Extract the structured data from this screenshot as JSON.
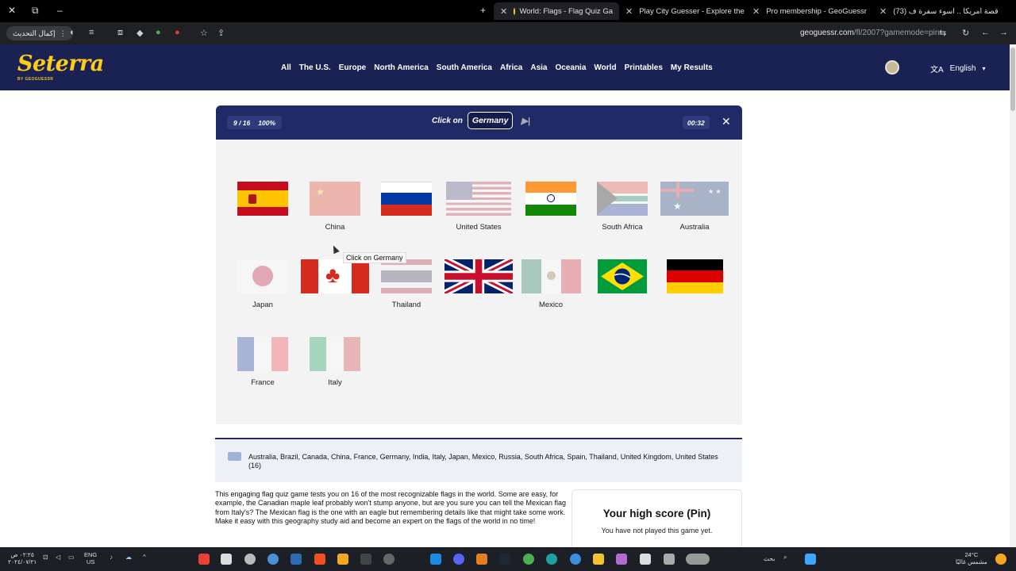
{
  "browser": {
    "tabs": [
      {
        "title": "World: Flags - Flag Quiz Ga",
        "active": true,
        "favicon_color": "#fecd19"
      },
      {
        "title": "Play City Guesser - Explore the",
        "active": false,
        "favicon_color": "#2b7de9"
      },
      {
        "title": "Pro membership - GeoGuessr",
        "active": false,
        "favicon_color": "#5b3cc4"
      },
      {
        "title": "(73) قصة امريكا .. اسوء سفرة ف",
        "active": false,
        "favicon_color": "#ff0000"
      }
    ],
    "new_tab": "+",
    "update_button": "إكمال التحديث",
    "url_host": "geoguessr.com",
    "url_path": "/fl/2007?gamemode=pin"
  },
  "site": {
    "logo": "Seterra",
    "logo_sub": "BY GEOGUESSR",
    "nav": [
      "All",
      "The U.S.",
      "Europe",
      "North America",
      "South America",
      "Africa",
      "Asia",
      "Oceania",
      "World",
      "Printables",
      "My Results"
    ],
    "language": "English"
  },
  "game": {
    "progress": "9 / 16",
    "accuracy": "100%",
    "prompt": "Click on",
    "target": "Germany",
    "timer": "00:32",
    "tooltip": "Click on Germany",
    "flags": [
      {
        "name": "",
        "country": "spain",
        "found": false
      },
      {
        "name": "China",
        "country": "china",
        "found": true
      },
      {
        "name": "",
        "country": "russia",
        "found": false
      },
      {
        "name": "United States",
        "country": "usa",
        "found": true
      },
      {
        "name": "",
        "country": "india",
        "found": false
      },
      {
        "name": "South Africa",
        "country": "south-africa",
        "found": true
      },
      {
        "name": "Australia",
        "country": "australia",
        "found": true
      },
      {
        "name": "Japan",
        "country": "japan",
        "found": true
      },
      {
        "name": "",
        "country": "canada",
        "found": false
      },
      {
        "name": "Thailand",
        "country": "thailand",
        "found": true
      },
      {
        "name": "",
        "country": "uk",
        "found": false
      },
      {
        "name": "Mexico",
        "country": "mexico",
        "found": true
      },
      {
        "name": "",
        "country": "brazil",
        "found": false
      },
      {
        "name": "",
        "country": "germany",
        "found": false
      },
      {
        "name": "France",
        "country": "france",
        "found": true
      },
      {
        "name": "Italy",
        "country": "italy",
        "found": true
      }
    ]
  },
  "info": {
    "countries": "Australia, Brazil, Canada, China, France, Germany, India, Italy, Japan, Mexico, Russia, South Africa, Spain, Thailand, United Kingdom, United States (16)",
    "description": "This engaging flag quiz game tests you on 16 of the most recognizable flags in the world. Some are easy, for example, the Canadian maple leaf probably won't stump anyone, but are you sure you can tell the Mexican flag from Italy's? The Mexican flag is the one with an eagle but remembering details like that might take some work. Make it easy with this geography study aid and become an expert on the flags of the world in no time!",
    "high_score_title": "Your high score (Pin)",
    "high_score_text": "You have not played this game yet."
  },
  "taskbar": {
    "time": "٠٢:٢٥ ص",
    "date": "٢٠٢٤/٠٧/٢١",
    "lang_top": "ENG",
    "lang_bottom": "US",
    "search": "بحث",
    "weather_temp": "24°C",
    "weather_text": "مشمس غالبًا"
  }
}
